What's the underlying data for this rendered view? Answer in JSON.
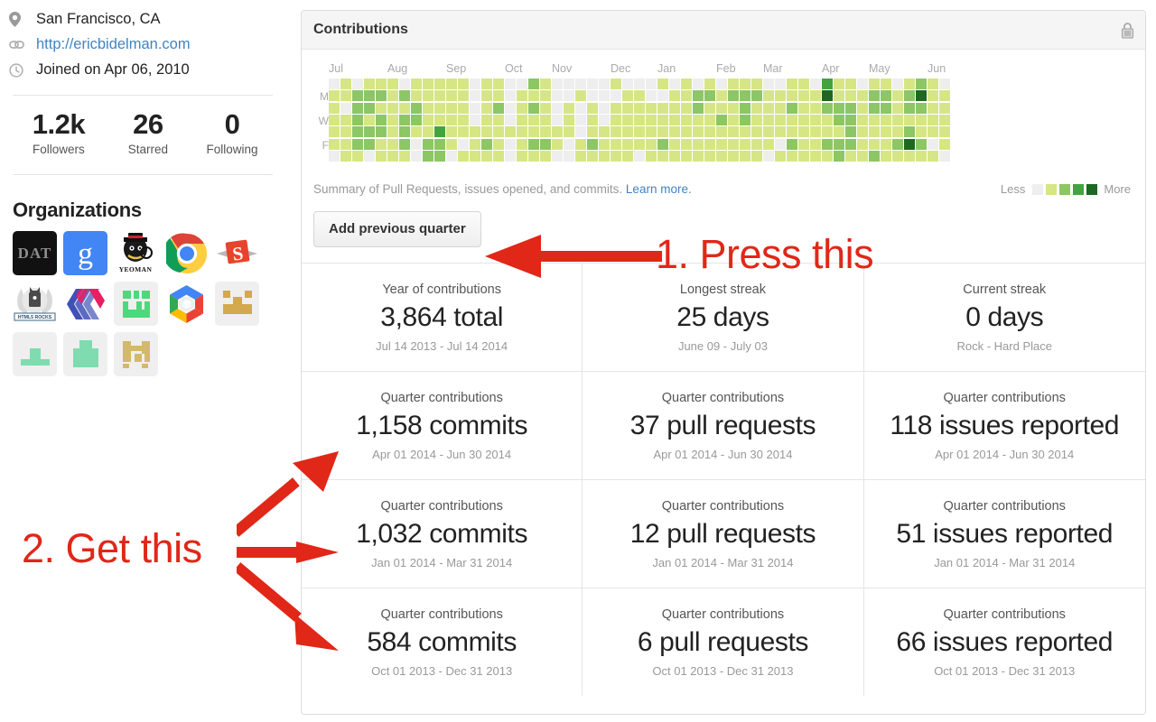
{
  "sidebar": {
    "meta": [
      {
        "icon": "location-pin-icon",
        "text": "San Francisco, CA",
        "is_link": false
      },
      {
        "icon": "link-icon",
        "text": "http://ericbidelman.com",
        "is_link": true
      },
      {
        "icon": "clock-icon",
        "text": "Joined on Apr 06, 2010",
        "is_link": false
      }
    ],
    "stats": [
      {
        "value": "1.2k",
        "label": "Followers"
      },
      {
        "value": "26",
        "label": "Starred"
      },
      {
        "value": "0",
        "label": "Following"
      }
    ],
    "organizations_title": "Organizations",
    "organizations": [
      {
        "name": "dat",
        "label": "DAT"
      },
      {
        "name": "google",
        "label": "g"
      },
      {
        "name": "yeoman",
        "label": "YEOMAN"
      },
      {
        "name": "chrome",
        "label": ""
      },
      {
        "name": "sencha",
        "label": "S"
      },
      {
        "name": "html5rocks",
        "label": "HTML5 ROCKS"
      },
      {
        "name": "polymer",
        "label": ""
      },
      {
        "name": "org-green-1",
        "label": ""
      },
      {
        "name": "google-cloud",
        "label": ""
      },
      {
        "name": "org-tan-1",
        "label": ""
      },
      {
        "name": "org-mint-1",
        "label": ""
      },
      {
        "name": "org-mint-2",
        "label": ""
      },
      {
        "name": "org-tan-2",
        "label": ""
      }
    ]
  },
  "panel": {
    "title": "Contributions",
    "lock_icon": "lock-icon",
    "summary_text": "Summary of Pull Requests, issues opened, and commits.",
    "learn_more": "Learn more.",
    "legend": {
      "less": "Less",
      "more": "More"
    },
    "add_quarter_button": "Add previous quarter"
  },
  "chart_data": {
    "type": "heatmap",
    "title": "Contributions",
    "months": [
      "Jul",
      "Aug",
      "Sep",
      "Oct",
      "Nov",
      "Dec",
      "Jan",
      "Feb",
      "Mar",
      "Apr",
      "May",
      "Jun"
    ],
    "month_col_index": [
      0,
      5,
      10,
      15,
      19,
      24,
      28,
      33,
      37,
      42,
      46,
      51
    ],
    "day_labels": [
      "M",
      "W",
      "F"
    ],
    "day_label_rows": [
      1,
      3,
      5
    ],
    "colors": [
      "#eeeeee",
      "#d6e685",
      "#8cc665",
      "#44a340",
      "#1e6823"
    ],
    "legend_labels": {
      "low": "Less",
      "high": "More"
    },
    "columns": 53,
    "rows": 7,
    "levels": [
      [
        0,
        1,
        1,
        1,
        1,
        1,
        0
      ],
      [
        1,
        1,
        0,
        1,
        1,
        1,
        1
      ],
      [
        0,
        2,
        2,
        2,
        2,
        2,
        1
      ],
      [
        1,
        2,
        2,
        1,
        2,
        2,
        0
      ],
      [
        1,
        2,
        1,
        2,
        2,
        1,
        1
      ],
      [
        1,
        1,
        1,
        1,
        1,
        1,
        1
      ],
      [
        0,
        2,
        1,
        2,
        2,
        2,
        1
      ],
      [
        1,
        1,
        2,
        2,
        1,
        0,
        0
      ],
      [
        1,
        1,
        1,
        1,
        1,
        2,
        2
      ],
      [
        1,
        1,
        1,
        1,
        3,
        2,
        2
      ],
      [
        1,
        1,
        1,
        1,
        1,
        1,
        0
      ],
      [
        1,
        1,
        1,
        1,
        1,
        0,
        1
      ],
      [
        0,
        0,
        0,
        0,
        1,
        1,
        1
      ],
      [
        1,
        1,
        1,
        1,
        1,
        2,
        1
      ],
      [
        1,
        1,
        2,
        1,
        1,
        1,
        1
      ],
      [
        0,
        0,
        0,
        0,
        1,
        0,
        0
      ],
      [
        0,
        1,
        1,
        1,
        1,
        1,
        1
      ],
      [
        2,
        1,
        2,
        1,
        1,
        2,
        1
      ],
      [
        1,
        1,
        1,
        1,
        1,
        2,
        1
      ],
      [
        0,
        0,
        0,
        0,
        1,
        1,
        0
      ],
      [
        0,
        0,
        1,
        1,
        1,
        0,
        0
      ],
      [
        0,
        1,
        0,
        0,
        0,
        1,
        1
      ],
      [
        0,
        0,
        1,
        1,
        1,
        2,
        1
      ],
      [
        0,
        0,
        0,
        0,
        1,
        1,
        1
      ],
      [
        1,
        0,
        1,
        1,
        1,
        1,
        1
      ],
      [
        0,
        1,
        1,
        1,
        1,
        1,
        1
      ],
      [
        0,
        1,
        1,
        1,
        1,
        1,
        0
      ],
      [
        0,
        0,
        1,
        1,
        1,
        1,
        1
      ],
      [
        1,
        0,
        1,
        1,
        1,
        2,
        1
      ],
      [
        0,
        1,
        1,
        1,
        1,
        1,
        1
      ],
      [
        1,
        1,
        1,
        1,
        1,
        1,
        1
      ],
      [
        0,
        2,
        2,
        1,
        1,
        1,
        1
      ],
      [
        1,
        2,
        1,
        1,
        1,
        1,
        1
      ],
      [
        0,
        1,
        1,
        2,
        1,
        1,
        1
      ],
      [
        1,
        2,
        1,
        1,
        1,
        1,
        1
      ],
      [
        1,
        2,
        2,
        2,
        1,
        1,
        1
      ],
      [
        1,
        2,
        1,
        1,
        1,
        1,
        1
      ],
      [
        0,
        1,
        1,
        1,
        1,
        1,
        0
      ],
      [
        0,
        1,
        1,
        1,
        1,
        0,
        1
      ],
      [
        1,
        1,
        2,
        1,
        1,
        2,
        1
      ],
      [
        1,
        1,
        1,
        1,
        1,
        1,
        1
      ],
      [
        0,
        1,
        1,
        1,
        1,
        1,
        1
      ],
      [
        3,
        4,
        2,
        1,
        1,
        2,
        1
      ],
      [
        1,
        1,
        2,
        2,
        1,
        2,
        2
      ],
      [
        1,
        1,
        2,
        2,
        2,
        2,
        1
      ],
      [
        0,
        1,
        1,
        1,
        1,
        1,
        1
      ],
      [
        1,
        2,
        2,
        1,
        1,
        1,
        2
      ],
      [
        1,
        2,
        2,
        1,
        1,
        1,
        1
      ],
      [
        0,
        1,
        1,
        1,
        1,
        2,
        1
      ],
      [
        1,
        2,
        2,
        1,
        2,
        4,
        1
      ],
      [
        2,
        4,
        2,
        1,
        1,
        2,
        1
      ],
      [
        1,
        1,
        1,
        1,
        1,
        0,
        1
      ],
      [
        0,
        1,
        1,
        1,
        1,
        1,
        0
      ]
    ]
  },
  "stat_table": {
    "rows": [
      [
        {
          "label": "Year of contributions",
          "value": "3,864 total",
          "sub": "Jul 14 2013 - Jul 14 2014"
        },
        {
          "label": "Longest streak",
          "value": "25 days",
          "sub": "June 09 - July 03"
        },
        {
          "label": "Current streak",
          "value": "0 days",
          "sub": "Rock - Hard Place"
        }
      ],
      [
        {
          "label": "Quarter contributions",
          "value": "1,158 commits",
          "sub": "Apr 01 2014 - Jun 30 2014"
        },
        {
          "label": "Quarter contributions",
          "value": "37 pull requests",
          "sub": "Apr 01 2014 - Jun 30 2014"
        },
        {
          "label": "Quarter contributions",
          "value": "118 issues reported",
          "sub": "Apr 01 2014 - Jun 30 2014"
        }
      ],
      [
        {
          "label": "Quarter contributions",
          "value": "1,032 commits",
          "sub": "Jan 01 2014 - Mar 31 2014"
        },
        {
          "label": "Quarter contributions",
          "value": "12 pull requests",
          "sub": "Jan 01 2014 - Mar 31 2014"
        },
        {
          "label": "Quarter contributions",
          "value": "51 issues reported",
          "sub": "Jan 01 2014 - Mar 31 2014"
        }
      ],
      [
        {
          "label": "Quarter contributions",
          "value": "584 commits",
          "sub": "Oct 01 2013 - Dec 31 2013"
        },
        {
          "label": "Quarter contributions",
          "value": "6 pull requests",
          "sub": "Oct 01 2013 - Dec 31 2013"
        },
        {
          "label": "Quarter contributions",
          "value": "66 issues reported",
          "sub": "Oct 01 2013 - Dec 31 2013"
        }
      ]
    ]
  },
  "annotations": {
    "color": "#e02718",
    "step1": "1. Press this",
    "step2": "2. Get this"
  }
}
